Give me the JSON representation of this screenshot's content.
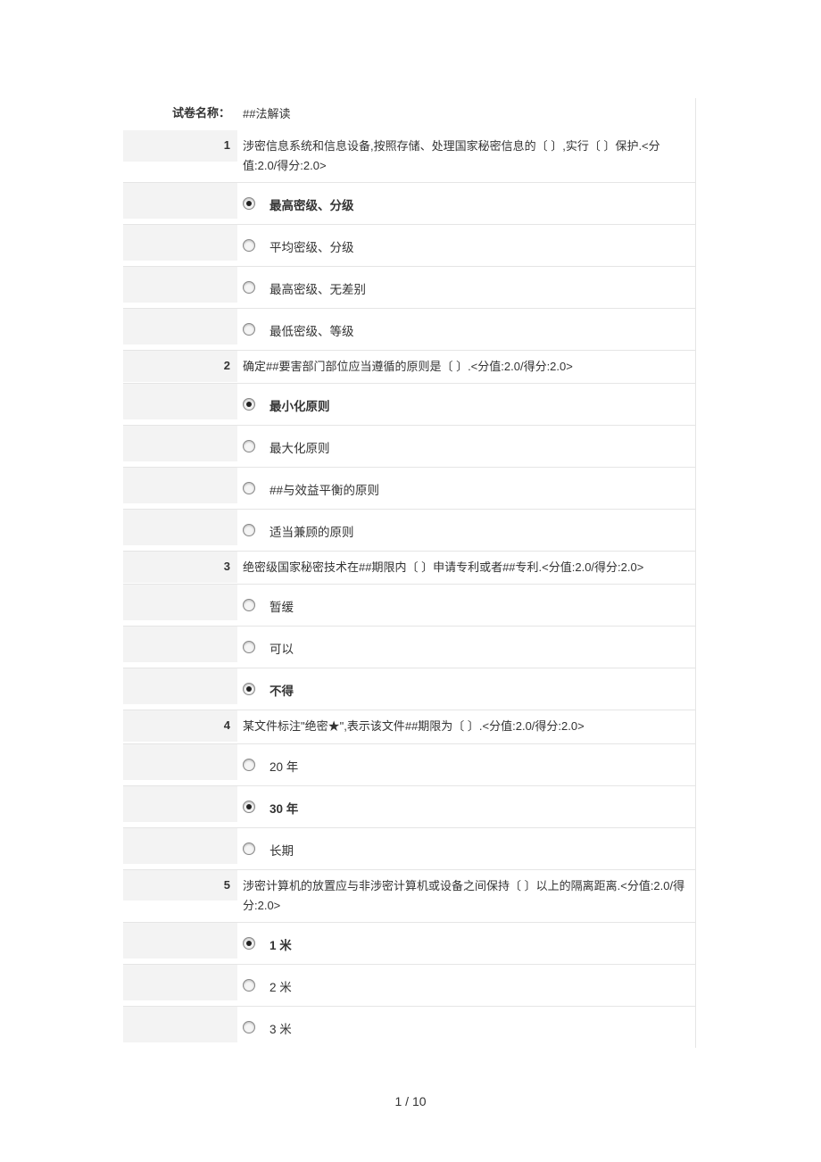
{
  "header": {
    "title_label": "试卷名称：",
    "title_value": "##法解读"
  },
  "questions": [
    {
      "number": "1",
      "text": "涉密信息系统和信息设备,按照存储、处理国家秘密信息的〔 〕,实行〔 〕保护.<分值:2.0/得分:2.0>",
      "options": [
        {
          "label": "最高密级、分级",
          "selected": true
        },
        {
          "label": "平均密级、分级",
          "selected": false
        },
        {
          "label": "最高密级、无差别",
          "selected": false
        },
        {
          "label": "最低密级、等级",
          "selected": false
        }
      ]
    },
    {
      "number": "2",
      "text": "确定##要害部门部位应当遵循的原则是〔 〕.<分值:2.0/得分:2.0>",
      "options": [
        {
          "label": "最小化原则",
          "selected": true
        },
        {
          "label": "最大化原则",
          "selected": false
        },
        {
          "label": "##与效益平衡的原则",
          "selected": false
        },
        {
          "label": "适当兼顾的原则",
          "selected": false
        }
      ]
    },
    {
      "number": "3",
      "text": "绝密级国家秘密技术在##期限内〔 〕申请专利或者##专利.<分值:2.0/得分:2.0>",
      "options": [
        {
          "label": "暂缓",
          "selected": false
        },
        {
          "label": "可以",
          "selected": false
        },
        {
          "label": "不得",
          "selected": true
        }
      ]
    },
    {
      "number": "4",
      "text": "某文件标注\"绝密★\",表示该文件##期限为〔 〕.<分值:2.0/得分:2.0>",
      "options": [
        {
          "label": "20 年",
          "selected": false
        },
        {
          "label": "30 年",
          "selected": true
        },
        {
          "label": "长期",
          "selected": false
        }
      ]
    },
    {
      "number": "5",
      "text": "涉密计算机的放置应与非涉密计算机或设备之间保持〔 〕以上的隔离距离.<分值:2.0/得分:2.0>",
      "options": [
        {
          "label": "1 米",
          "selected": true
        },
        {
          "label": "2 米",
          "selected": false
        },
        {
          "label": "3 米",
          "selected": false
        }
      ]
    }
  ],
  "footer": {
    "page_indicator": "1 / 10"
  }
}
